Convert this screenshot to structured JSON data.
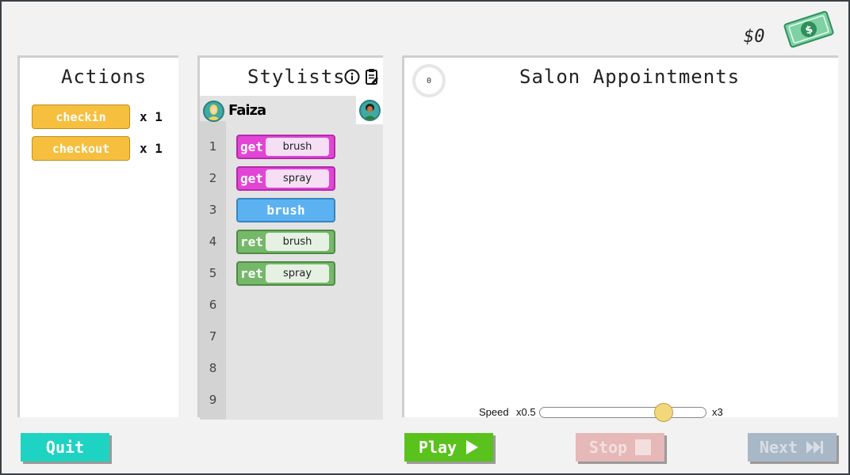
{
  "header": {
    "money": "$0"
  },
  "actions": {
    "title": "Actions",
    "items": [
      {
        "label": "checkin",
        "count": "x 1"
      },
      {
        "label": "checkout",
        "count": "x 1"
      }
    ]
  },
  "stylists": {
    "title": "Stylists",
    "name": "Faiza",
    "line_numbers": [
      "1",
      "2",
      "3",
      "4",
      "5",
      "6",
      "7",
      "8",
      "9"
    ],
    "blocks": [
      {
        "keyword": "get",
        "arg": "brush"
      },
      {
        "keyword": "get",
        "arg": "spray"
      },
      {
        "keyword": "brush"
      },
      {
        "keyword": "ret",
        "arg": "brush"
      },
      {
        "keyword": "ret",
        "arg": "spray"
      }
    ]
  },
  "salon": {
    "title": "Salon Appointments",
    "timer": "0",
    "speed": {
      "label": "Speed",
      "min_label": "x0.5",
      "max_label": "x3",
      "min": 0.5,
      "max": 3,
      "value": 2.45
    }
  },
  "controls": {
    "quit": "Quit",
    "play": "Play",
    "stop": "Stop",
    "next": "Next"
  },
  "colors": {
    "checkin_button": "#f6bf3e",
    "get_block": "#e145d6",
    "ret_block": "#75b86a",
    "plain_block": "#5cb2f1",
    "quit_button": "#1ed3c1",
    "play_button": "#5ac21c",
    "stop_button_disabled": "#e6b8b8",
    "next_button_disabled": "#a9b8c7"
  }
}
